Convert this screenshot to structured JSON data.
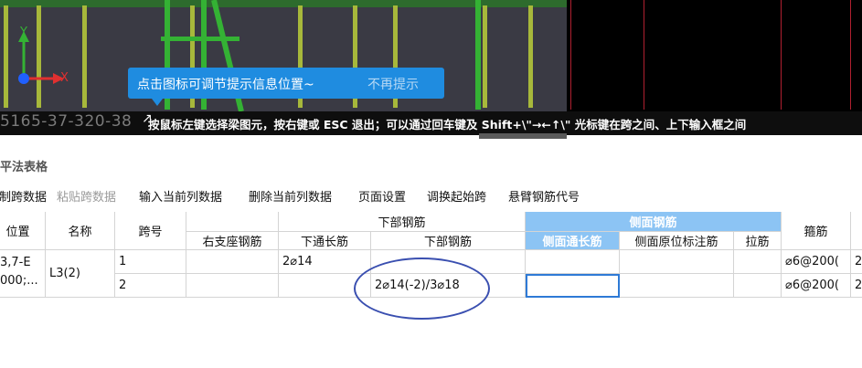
{
  "viewport": {
    "axis_x_label": "X",
    "axis_y_label": "Y",
    "tip_message": "点击图标可调节提示信息位置~",
    "tip_dismiss": "不再提示",
    "faint_coords": "5165-37-320-38",
    "instruction": "按鼠标左键选择梁图元，按右键或 ESC 退出；可以通过回车键及 Shift+\\\"→←↑\\\" 光标键在跨之间、上下输入框之间",
    "colors": {
      "axis_green": "#34b234",
      "axis_red": "#e03030",
      "axis_blue": "#2060ff",
      "tip_blue": "#1f8ce0"
    }
  },
  "panel": {
    "title": "平法表格",
    "toolbar": [
      "复制跨数据",
      "粘贴跨数据",
      "输入当前列数据",
      "删除当前列数据",
      "页面设置",
      "调换起始跨",
      "悬臂钢筋代号"
    ],
    "toolbar_disabled": [
      "粘贴跨数据"
    ]
  },
  "table": {
    "headers": {
      "position": "位置",
      "name": "名称",
      "span_no": "跨号",
      "right_support": "右支座钢筋",
      "bottom_group": "下部钢筋",
      "bottom_through": "下通长筋",
      "bottom_rebar": "下部钢筋",
      "side_group": "侧面钢筋",
      "side_through": "侧面通长筋",
      "side_in_situ": "侧面原位标注筋",
      "tie": "拉筋",
      "stirrup": "箍筋"
    },
    "position_line1": "3,7-E",
    "position_line2": "000;...",
    "name": "L3(2)",
    "rows": [
      {
        "span": "1",
        "right_support": "",
        "bottom_through": "2⌀14",
        "bottom_rebar": "",
        "side_through": "",
        "side_in_situ": "",
        "tie": "",
        "stirrup": "⌀6@200(",
        "extra": "2"
      },
      {
        "span": "2",
        "right_support": "",
        "bottom_through": "",
        "bottom_rebar": "2⌀14(-2)/3⌀18",
        "side_through": "",
        "side_in_situ": "",
        "tie": "",
        "stirrup": "⌀6@200(",
        "extra": "2"
      }
    ]
  }
}
